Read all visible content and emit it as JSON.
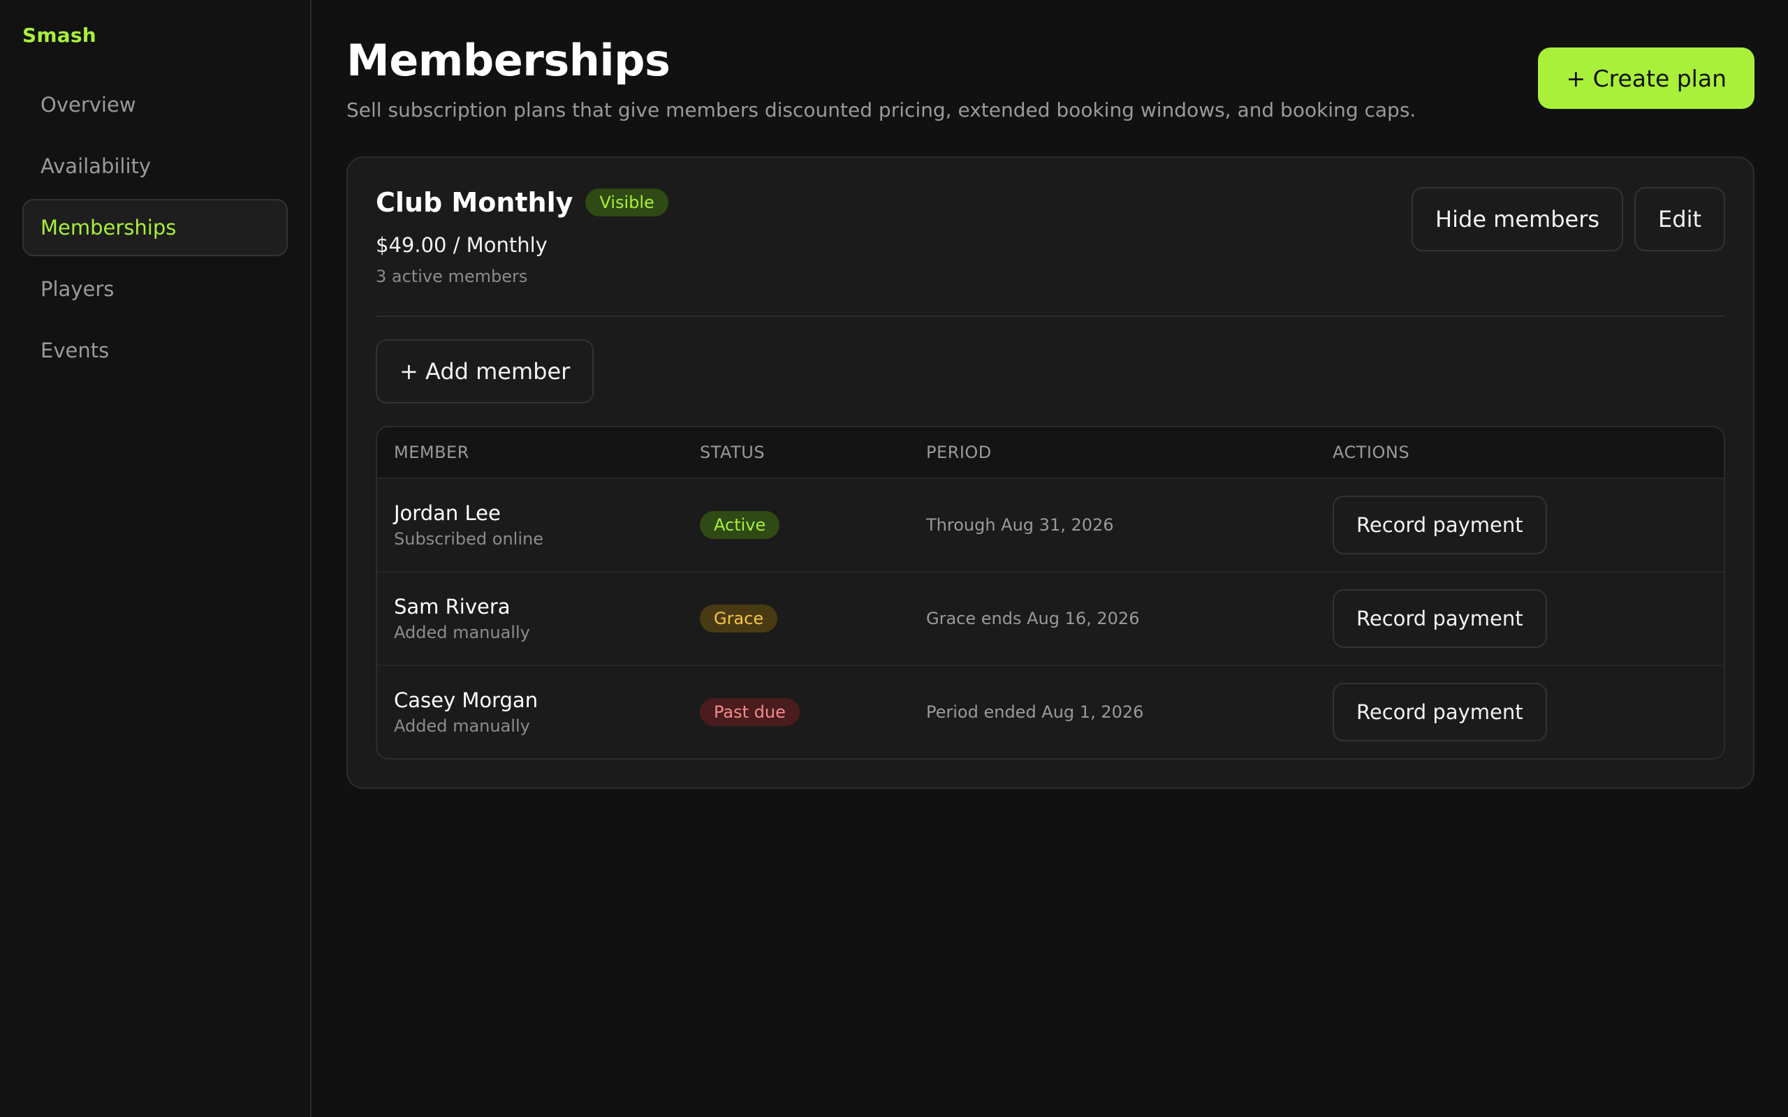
{
  "brand": {
    "name": "Smash",
    "accent_color": "#a8f03a"
  },
  "sidebar": {
    "items": [
      {
        "label": "Overview",
        "active": false
      },
      {
        "label": "Availability",
        "active": false
      },
      {
        "label": "Memberships",
        "active": true
      },
      {
        "label": "Players",
        "active": false
      },
      {
        "label": "Events",
        "active": false
      }
    ]
  },
  "header": {
    "title": "Memberships",
    "subtitle": "Sell subscription plans that give members discounted pricing, extended booking windows, and booking caps.",
    "create_button": "+ Create plan"
  },
  "plan": {
    "name": "Club Monthly",
    "visibility_badge": "Visible",
    "price": "$49.00 / Monthly",
    "member_count": "3 active members",
    "hide_button": "Hide members",
    "edit_button": "Edit",
    "add_member_button": "+ Add member"
  },
  "table": {
    "columns": [
      "MEMBER",
      "STATUS",
      "PERIOD",
      "ACTIONS"
    ],
    "rows": [
      {
        "name": "Jordan Lee",
        "source": "Subscribed online",
        "status": "Active",
        "period": "Through Aug 31, 2026",
        "action": "Record payment"
      },
      {
        "name": "Sam Rivera",
        "source": "Added manually",
        "status": "Grace",
        "period": "Grace ends Aug 16, 2026",
        "action": "Record payment"
      },
      {
        "name": "Casey Morgan",
        "source": "Added manually",
        "status": "Past due",
        "period": "Period ended Aug 1, 2026",
        "action": "Record payment"
      }
    ]
  },
  "status_colors": {
    "Active": "#a8f03a",
    "Grace": "#f5c542",
    "Past due": "#f28b8b"
  }
}
